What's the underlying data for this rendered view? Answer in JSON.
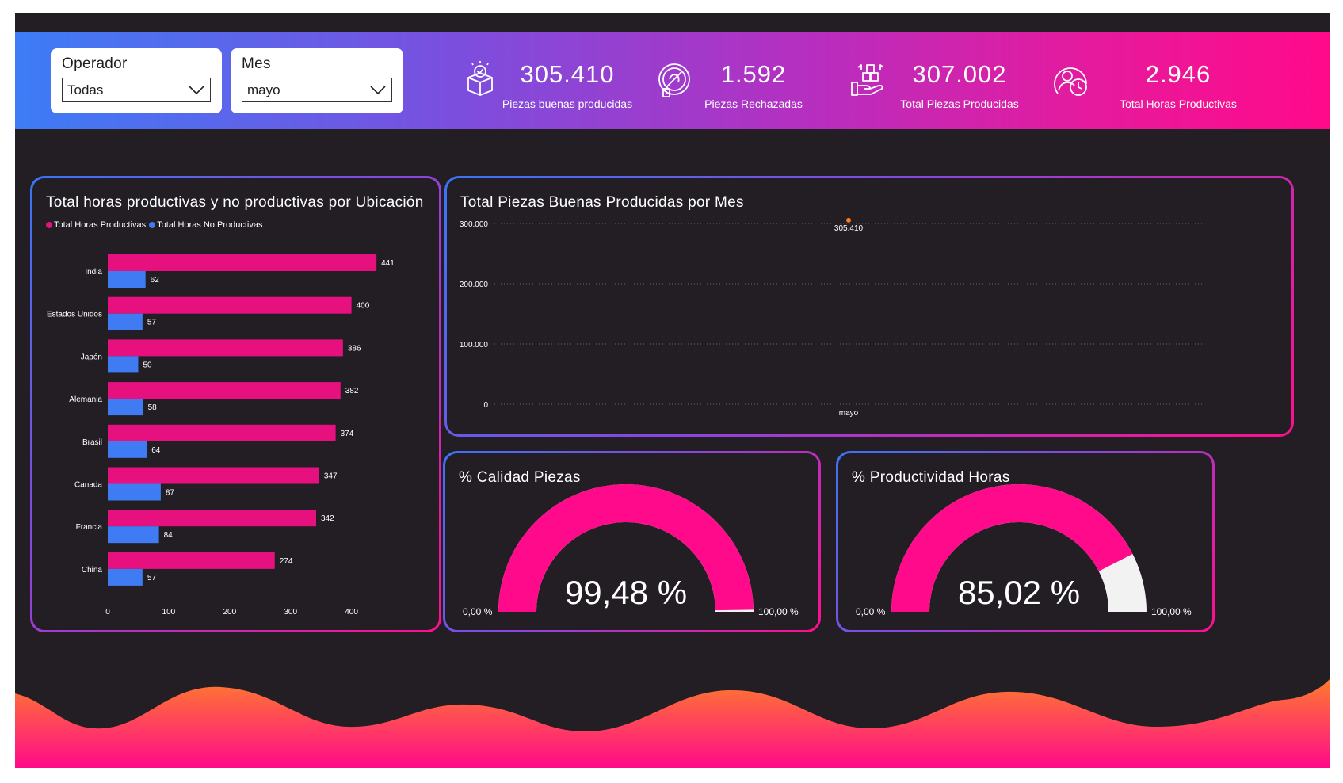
{
  "slicers": [
    {
      "title": "Operador",
      "value": "Todas"
    },
    {
      "title": "Mes",
      "value": "mayo"
    }
  ],
  "kpis": [
    {
      "value": "305.410",
      "label": "Piezas buenas producidas",
      "icon": "box-check-icon"
    },
    {
      "value": "1.592",
      "label": "Piezas Rechazadas",
      "icon": "reject-badge-icon"
    },
    {
      "value": "307.002",
      "label": "Total Piezas Producidas",
      "icon": "hand-boxes-icon"
    },
    {
      "value": "2.946",
      "label": "Total Horas Productivas",
      "icon": "person-clock-icon"
    }
  ],
  "hours_chart": {
    "title": "Total horas productivas y no productivas por Ubicación",
    "legend": [
      {
        "name": "Total Horas Productivas",
        "color": "#e6117f"
      },
      {
        "name": "Total Horas No Productivas",
        "color": "#3f7cf4"
      }
    ]
  },
  "pieces_chart": {
    "title": "Total Piezas Buenas Producidas por Mes"
  },
  "gauges": [
    {
      "title": "% Calidad Piezas",
      "value_label": "99,48 %",
      "fraction": 0.9948,
      "min_label": "0,00 %",
      "max_label": "100,00 %"
    },
    {
      "title": "% Productividad Horas",
      "value_label": "85,02 %",
      "fraction": 0.8502,
      "min_label": "0,00 %",
      "max_label": "100,00 %"
    }
  ],
  "colors": {
    "productive": "#e6117f",
    "non_productive": "#3f7cf4",
    "gauge_fill": "#ff0a8a",
    "gauge_track": "#f2f2f2",
    "line_point": "#ff7a1a"
  },
  "chart_data": [
    {
      "type": "bar",
      "orientation": "horizontal",
      "title": "Total horas productivas y no productivas por Ubicación",
      "categories": [
        "India",
        "Estados Unidos",
        "Japón",
        "Alemania",
        "Brasil",
        "Canada",
        "Francia",
        "China"
      ],
      "series": [
        {
          "name": "Total Horas Productivas",
          "values": [
            441,
            400,
            386,
            382,
            374,
            347,
            342,
            274
          ]
        },
        {
          "name": "Total Horas No Productivas",
          "values": [
            62,
            57,
            50,
            58,
            64,
            87,
            84,
            57
          ]
        }
      ],
      "xticks": [
        "0",
        "100",
        "200",
        "300",
        "400"
      ],
      "xlim": [
        0,
        440
      ],
      "legend_position": "top-left",
      "data_labels": true
    },
    {
      "type": "line",
      "title": "Total Piezas Buenas Producidas por Mes",
      "categories": [
        "mayo"
      ],
      "series": [
        {
          "values": [
            305410
          ],
          "labels": [
            "305.410"
          ]
        }
      ],
      "yticks": [
        "0",
        "100.000",
        "200.000",
        "300.000"
      ],
      "ylim": [
        0,
        300000
      ],
      "grid": true
    }
  ]
}
